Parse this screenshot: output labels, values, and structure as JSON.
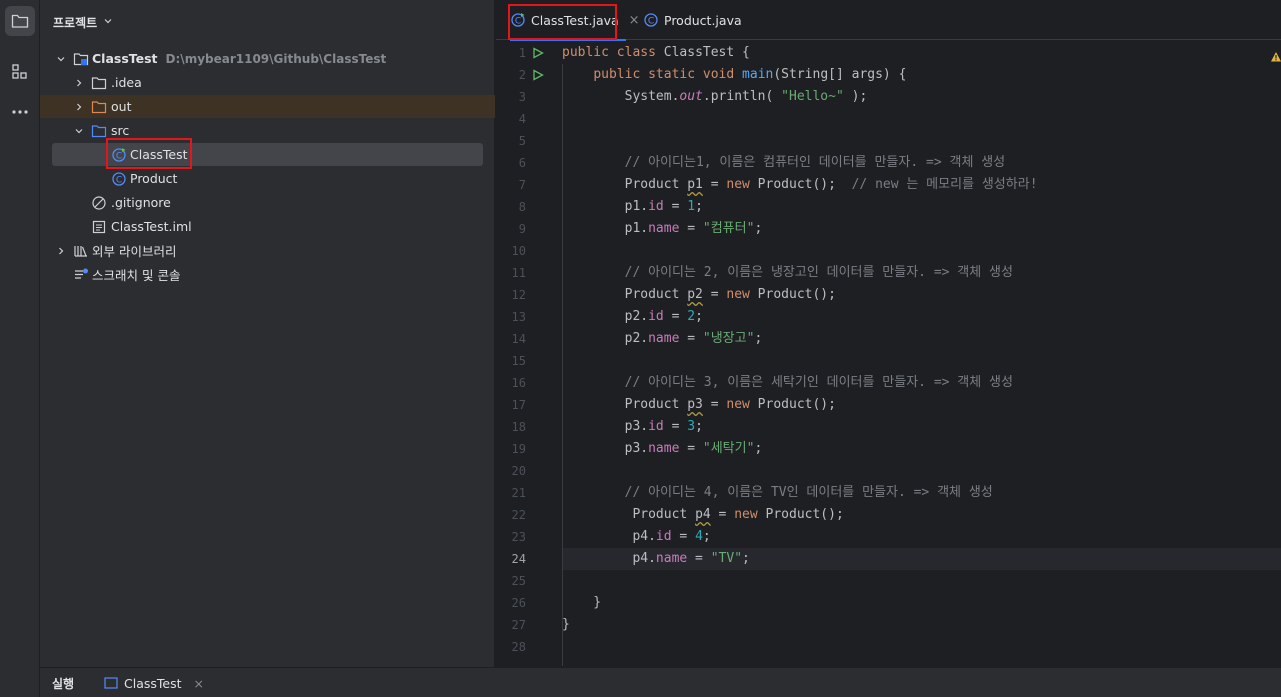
{
  "sidebar_tools": [
    {
      "name": "project-tool",
      "icon": "folder-icon"
    },
    {
      "name": "structure-tool",
      "icon": "structure-icon"
    },
    {
      "name": "more-tools",
      "icon": "more-icon"
    }
  ],
  "project_panel": {
    "title": "프로젝트",
    "tree": [
      {
        "label": "ClassTest",
        "hint": "D:\\mybear1109\\Github\\ClassTest"
      },
      {
        "label": ".idea"
      },
      {
        "label": "out"
      },
      {
        "label": "src"
      },
      {
        "label": "ClassTest"
      },
      {
        "label": "Product"
      },
      {
        "label": ".gitignore"
      },
      {
        "label": "ClassTest.iml"
      },
      {
        "label": "외부 라이브러리"
      },
      {
        "label": "스크래치 및 콘솔"
      }
    ]
  },
  "editor": {
    "tabs": [
      {
        "label": "ClassTest.java",
        "close": "×"
      },
      {
        "label": "Product.java"
      }
    ],
    "current_line": 24,
    "lines": [
      "public class ClassTest {",
      "    public static void main(String[] args) {",
      "        System.out.println( \"Hello~\" );",
      "",
      "",
      "        // 아이디는1, 이름은 컴퓨터인 데이터를 만들자. => 객체 생성",
      "        Product p1 = new Product();  // new 는 메모리를 생성하라!",
      "        p1.id = 1;",
      "        p1.name = \"컴퓨터\";",
      "",
      "        // 아이디는 2, 이름은 냉장고인 데이터를 만들자. => 객체 생성",
      "        Product p2 = new Product();",
      "        p2.id = 2;",
      "        p2.name = \"냉장고\";",
      "",
      "        // 아이디는 3, 이름은 세탁기인 데이터를 만들자. => 객체 생성",
      "        Product p3 = new Product();",
      "        p3.id = 3;",
      "        p3.name = \"세탁기\";",
      "",
      "        // 아이디는 4, 이름은 TV인 데이터를 만들자. => 객체 생성",
      "         Product p4 = new Product();",
      "         p4.id = 4;",
      "         p4.name = \"TV\";",
      "",
      "    }",
      "}",
      ""
    ],
    "line_numbers": [
      "1",
      "2",
      "3",
      "4",
      "5",
      "6",
      "7",
      "8",
      "9",
      "10",
      "11",
      "12",
      "13",
      "14",
      "15",
      "16",
      "17",
      "18",
      "19",
      "20",
      "21",
      "22",
      "23",
      "24",
      "25",
      "26",
      "27",
      "28"
    ]
  },
  "bottom_bar": {
    "run_label": "실행",
    "run_tab": "ClassTest",
    "close": "×"
  },
  "colors": {
    "highlight_box": "#e3161c",
    "keyword": "#cf8e6d",
    "string": "#6aab73",
    "number": "#2aacb8",
    "field": "#c77dbb",
    "comment": "#7a7e85",
    "method": "#56a8f5"
  }
}
